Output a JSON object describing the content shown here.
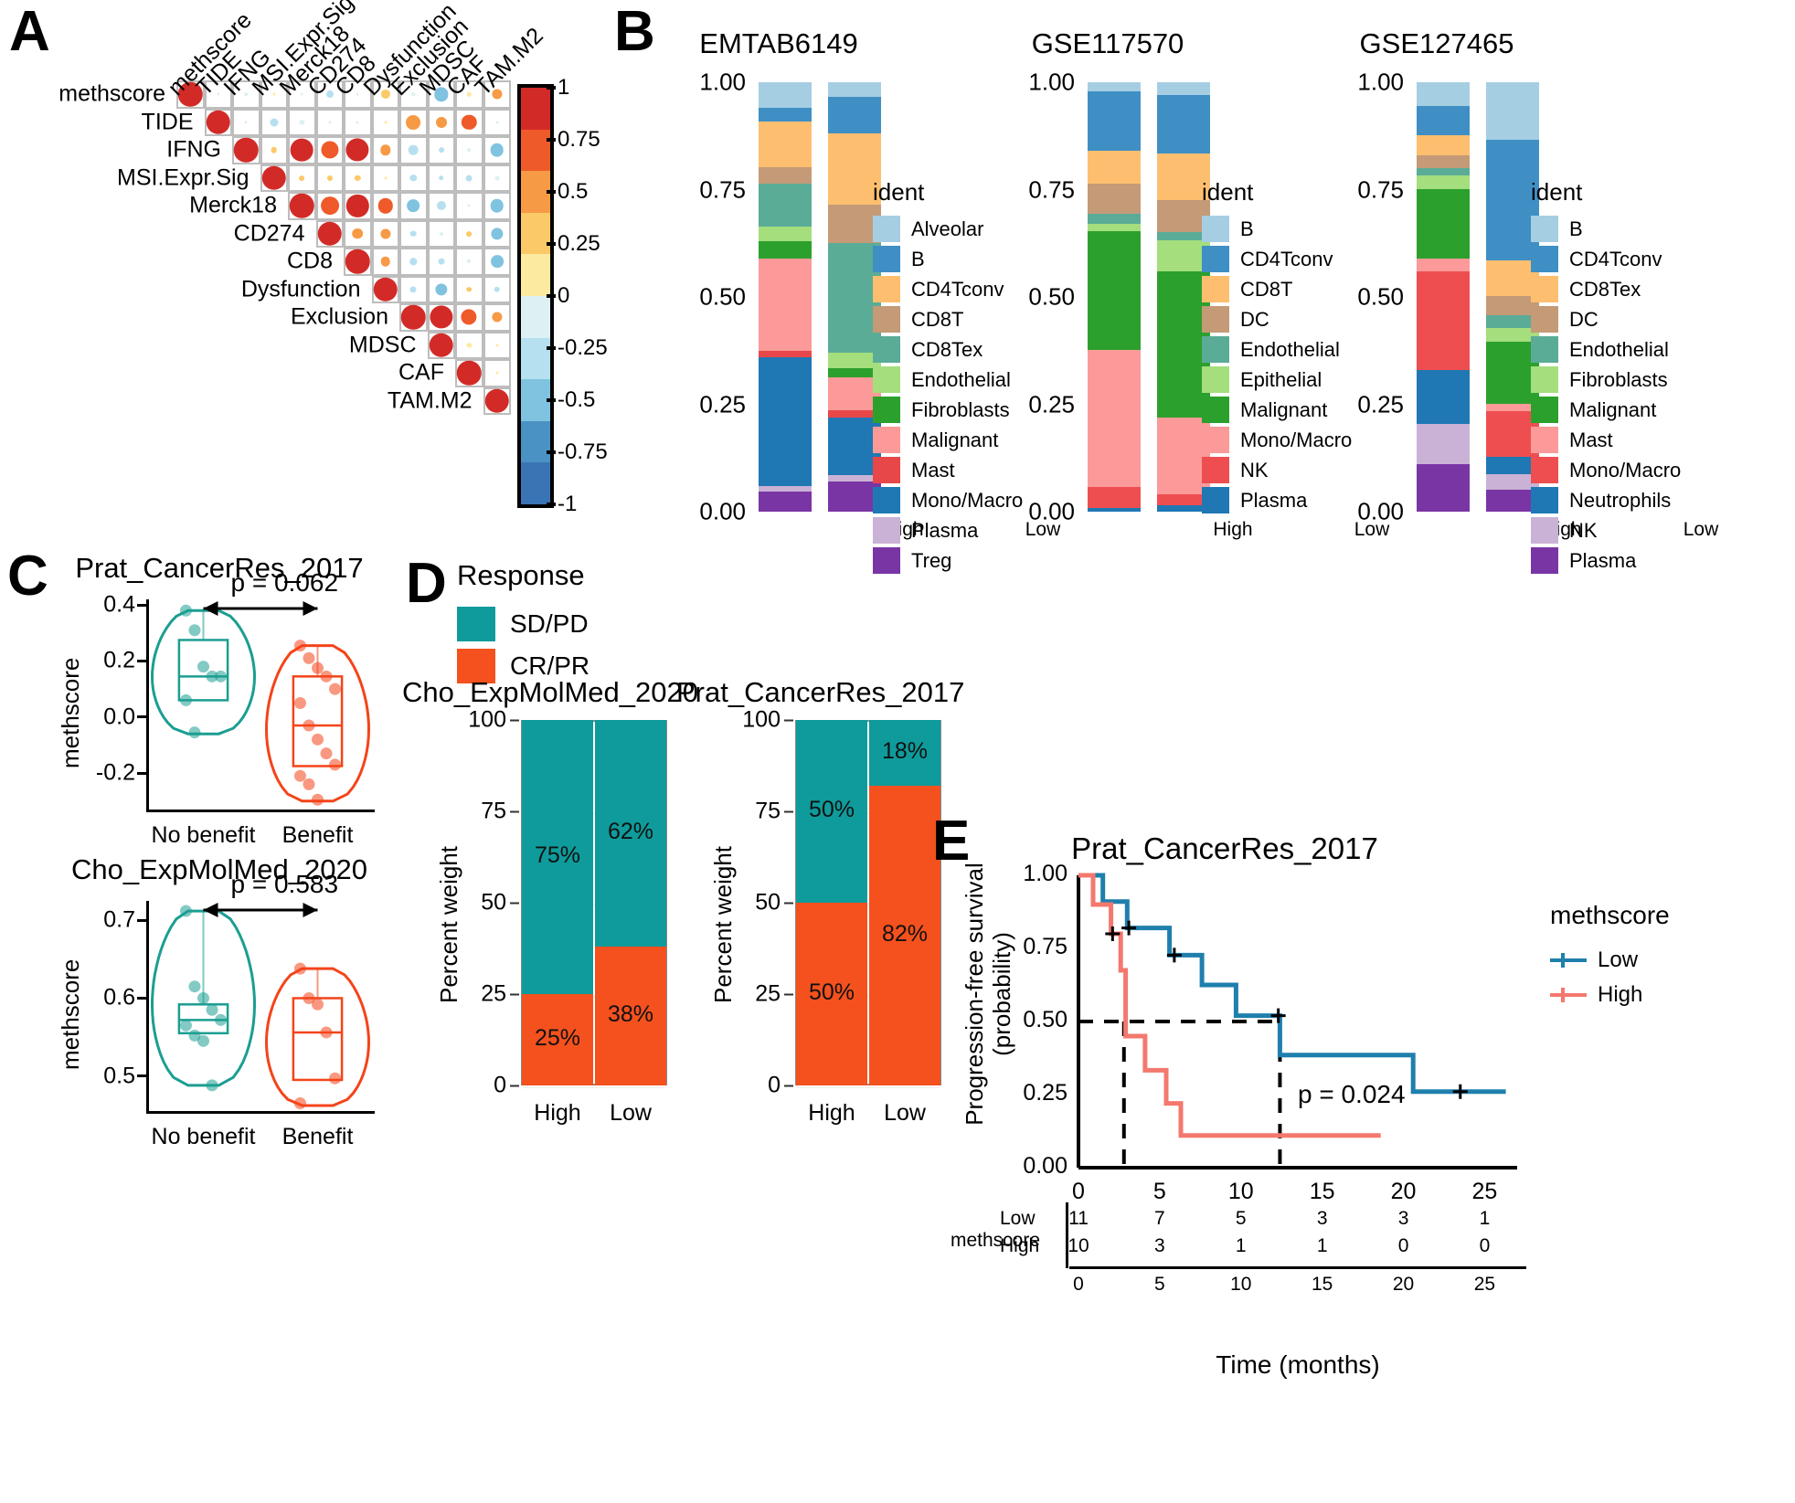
{
  "panels": {
    "A": {
      "letter": "A"
    },
    "B": {
      "letter": "B"
    },
    "C": {
      "letter": "C"
    },
    "D": {
      "letter": "D"
    },
    "E": {
      "letter": "E"
    }
  },
  "chart_data": [
    {
      "panel": "A",
      "type": "heatmap",
      "title": "",
      "subtype": "correlogram-upper-triangle",
      "labels": [
        "methscore",
        "TIDE",
        "IFNG",
        "MSI.Expr.Sig",
        "Merck18",
        "CD274",
        "CD8",
        "Dysfunction",
        "Exclusion",
        "MDSC",
        "CAF",
        "TAM.M2"
      ],
      "colorbar": {
        "ticks": [
          "1",
          "0.75",
          "0.5",
          "0.25",
          "0",
          "-0.25",
          "-0.5",
          "-0.75",
          "-1"
        ],
        "values": [
          1,
          0.75,
          0.5,
          0.25,
          0,
          -0.25,
          -0.5,
          -0.75,
          -1
        ],
        "colors": [
          "#d22b27",
          "#ef5a2a",
          "#f79a45",
          "#fbc968",
          "#fdeaa1",
          "#ddf0f3",
          "#b6e0ef",
          "#80c3e0",
          "#4b92c4",
          "#3a74b5"
        ]
      },
      "matrix": [
        [
          1.0,
          -0.12,
          -0.14,
          0.06,
          -0.11,
          -0.3,
          -0.08,
          0.38,
          -0.13,
          -0.58,
          0.17,
          0.42
        ],
        [
          null,
          1.0,
          -0.12,
          -0.34,
          -0.2,
          -0.05,
          -0.11,
          0.05,
          0.6,
          0.45,
          0.62,
          -0.1
        ],
        [
          null,
          null,
          1.0,
          0.25,
          0.93,
          0.72,
          0.95,
          0.43,
          -0.4,
          -0.22,
          -0.14,
          -0.55
        ],
        [
          null,
          null,
          null,
          1.0,
          0.22,
          0.23,
          0.24,
          0.07,
          -0.28,
          -0.21,
          -0.26,
          -0.18
        ],
        [
          null,
          null,
          null,
          null,
          1.0,
          0.75,
          0.92,
          0.62,
          -0.52,
          -0.38,
          -0.05,
          -0.55
        ],
        [
          null,
          null,
          null,
          null,
          null,
          1.0,
          0.44,
          0.42,
          -0.25,
          -0.15,
          0.22,
          -0.5
        ],
        [
          null,
          null,
          null,
          null,
          null,
          null,
          1.0,
          0.4,
          -0.28,
          -0.26,
          -0.16,
          -0.52
        ],
        [
          null,
          null,
          null,
          null,
          null,
          null,
          null,
          1.0,
          -0.27,
          -0.5,
          0.21,
          -0.25
        ],
        [
          null,
          null,
          null,
          null,
          null,
          null,
          null,
          null,
          1.0,
          0.95,
          0.65,
          0.42
        ],
        [
          null,
          null,
          null,
          null,
          null,
          null,
          null,
          null,
          null,
          1.0,
          0.2,
          0.12
        ],
        [
          null,
          null,
          null,
          null,
          null,
          null,
          null,
          null,
          null,
          null,
          1.0,
          0.08
        ],
        [
          null,
          null,
          null,
          null,
          null,
          null,
          null,
          null,
          null,
          null,
          null,
          1.0
        ]
      ]
    },
    {
      "panel": "B",
      "index": 0,
      "type": "bar",
      "stacked": true,
      "title": "EMTAB6149",
      "xlabel": "",
      "ylabel": "",
      "legend_title": "ident",
      "categories": [
        "High",
        "Low"
      ],
      "yticks": [
        "0.00",
        "0.25",
        "0.50",
        "0.75",
        "1.00"
      ],
      "ylim": [
        0,
        1
      ],
      "series": [
        {
          "name": "Alveolar",
          "color": "#a6cee3",
          "values": [
            0.06,
            0.035
          ]
        },
        {
          "name": "B",
          "color": "#3f8fc5",
          "values": [
            0.032,
            0.085
          ]
        },
        {
          "name": "CD4Tconv",
          "color": "#fdbf6f",
          "values": [
            0.105,
            0.165
          ]
        },
        {
          "name": "CD8T",
          "color": "#c49a77",
          "values": [
            0.04,
            0.09
          ]
        },
        {
          "name": "CD8Tex",
          "color": "#5aac97",
          "values": [
            0.1,
            0.255
          ]
        },
        {
          "name": "Endothelial",
          "color": "#a4de7d",
          "values": [
            0.033,
            0.035
          ]
        },
        {
          "name": "Fibroblasts",
          "color": "#2ca02c",
          "values": [
            0.04,
            0.022
          ]
        },
        {
          "name": "Malignant",
          "color": "#fb9a99",
          "values": [
            0.215,
            0.077
          ]
        },
        {
          "name": "Mast",
          "color": "#e8474a",
          "values": [
            0.015,
            0.016
          ]
        },
        {
          "name": "Mono/Macro",
          "color": "#1f78b4",
          "values": [
            0.3,
            0.135
          ]
        },
        {
          "name": "Plasma",
          "color": "#cab2d6",
          "values": [
            0.013,
            0.016
          ]
        },
        {
          "name": "Treg",
          "color": "#7a35a5",
          "values": [
            0.047,
            0.069
          ]
        }
      ]
    },
    {
      "panel": "B",
      "index": 1,
      "type": "bar",
      "stacked": true,
      "title": "GSE117570",
      "xlabel": "",
      "ylabel": "",
      "legend_title": "ident",
      "categories": [
        "High",
        "Low"
      ],
      "yticks": [
        "0.00",
        "0.25",
        "0.50",
        "0.75",
        "1.00"
      ],
      "ylim": [
        0,
        1
      ],
      "series": [
        {
          "name": "B",
          "color": "#a6cee3",
          "values": [
            0.022,
            0.03
          ]
        },
        {
          "name": "CD4Tconv",
          "color": "#3f8fc5",
          "values": [
            0.137,
            0.135
          ]
        },
        {
          "name": "CD8T",
          "color": "#fdbf6f",
          "values": [
            0.078,
            0.11
          ]
        },
        {
          "name": "DC",
          "color": "#c49a77",
          "values": [
            0.07,
            0.075
          ]
        },
        {
          "name": "Endothelial",
          "color": "#5aac97",
          "values": [
            0.023,
            0.018
          ]
        },
        {
          "name": "Epithelial",
          "color": "#a4de7d",
          "values": [
            0.016,
            0.072
          ]
        },
        {
          "name": "Malignant",
          "color": "#2ca02c",
          "values": [
            0.277,
            0.34
          ]
        },
        {
          "name": "Mono/Macro",
          "color": "#fb9a99",
          "values": [
            0.32,
            0.18
          ]
        },
        {
          "name": "NK",
          "color": "#ef4e50",
          "values": [
            0.049,
            0.025
          ]
        },
        {
          "name": "Plasma",
          "color": "#1f78b4",
          "values": [
            0.008,
            0.015
          ]
        }
      ]
    },
    {
      "panel": "B",
      "index": 2,
      "type": "bar",
      "stacked": true,
      "title": "GSE127465",
      "xlabel": "",
      "ylabel": "",
      "legend_title": "ident",
      "categories": [
        "High",
        "Low"
      ],
      "yticks": [
        "0.00",
        "0.25",
        "0.50",
        "0.75",
        "1.00"
      ],
      "ylim": [
        0,
        1
      ],
      "series": [
        {
          "name": "B",
          "color": "#a6cee3",
          "values": [
            0.055,
            0.135
          ]
        },
        {
          "name": "CD4Tconv",
          "color": "#3f8fc5",
          "values": [
            0.068,
            0.28
          ]
        },
        {
          "name": "CD8Tex",
          "color": "#fdbf6f",
          "values": [
            0.048,
            0.082
          ]
        },
        {
          "name": "DC",
          "color": "#c49a77",
          "values": [
            0.03,
            0.045
          ]
        },
        {
          "name": "Endothelial",
          "color": "#5aac97",
          "values": [
            0.017,
            0.03
          ]
        },
        {
          "name": "Fibroblasts",
          "color": "#a4de7d",
          "values": [
            0.03,
            0.032
          ]
        },
        {
          "name": "Malignant",
          "color": "#2ca02c",
          "values": [
            0.162,
            0.145
          ]
        },
        {
          "name": "Mast",
          "color": "#fb9a99",
          "values": [
            0.03,
            0.018
          ]
        },
        {
          "name": "Mono/Macro",
          "color": "#ef4e50",
          "values": [
            0.23,
            0.105
          ]
        },
        {
          "name": "Neutrophils",
          "color": "#1f78b4",
          "values": [
            0.125,
            0.04
          ]
        },
        {
          "name": "NK",
          "color": "#cab2d6",
          "values": [
            0.095,
            0.038
          ]
        },
        {
          "name": "Plasma",
          "color": "#7a35a5",
          "values": [
            0.11,
            0.05
          ]
        }
      ]
    },
    {
      "panel": "C",
      "index": 0,
      "type": "scatter",
      "subtype": "violin-box",
      "title": "Prat_CancerRes_2017",
      "xlabel": "",
      "ylabel": "methscore",
      "categories": [
        "No benefit",
        "Benefit"
      ],
      "yticks": [
        "0.4",
        "0.2",
        "0.0",
        "-0.2"
      ],
      "ylim": [
        -0.33,
        0.42
      ],
      "annotation": "p =  0.062",
      "groups": [
        {
          "name": "No benefit",
          "color": "#1b9e91",
          "q1": 0.06,
          "median": 0.145,
          "q3": 0.275,
          "min": -0.06,
          "max": 0.38,
          "points": [
            0.38,
            0.31,
            0.18,
            0.145,
            0.145,
            0.06,
            -0.055
          ]
        },
        {
          "name": "Benefit",
          "color": "#f4441a",
          "q1": -0.175,
          "median": -0.03,
          "q3": 0.145,
          "min": -0.3,
          "max": 0.255,
          "points": [
            0.255,
            0.21,
            0.175,
            0.145,
            0.1,
            0.05,
            -0.03,
            -0.08,
            -0.13,
            -0.17,
            -0.21,
            -0.24,
            -0.295
          ]
        }
      ]
    },
    {
      "panel": "C",
      "index": 1,
      "type": "scatter",
      "subtype": "violin-box",
      "title": "Cho_ExpMolMed_2020",
      "xlabel": "",
      "ylabel": "methscore",
      "categories": [
        "No benefit",
        "Benefit"
      ],
      "yticks": [
        "0.7",
        "0.6",
        "0.5"
      ],
      "ylim": [
        0.455,
        0.725
      ],
      "annotation": "p =  0.583",
      "groups": [
        {
          "name": "No benefit",
          "color": "#1b9e91",
          "q1": 0.555,
          "median": 0.572,
          "q3": 0.592,
          "min": 0.488,
          "max": 0.712,
          "points": [
            0.712,
            0.615,
            0.6,
            0.585,
            0.572,
            0.565,
            0.552,
            0.545,
            0.488
          ]
        },
        {
          "name": "Benefit",
          "color": "#f4441a",
          "q1": 0.495,
          "median": 0.556,
          "q3": 0.6,
          "min": 0.462,
          "max": 0.638,
          "points": [
            0.638,
            0.6,
            0.592,
            0.556,
            0.497,
            0.465
          ]
        }
      ]
    },
    {
      "panel": "D",
      "index": 0,
      "type": "bar",
      "stacked": true,
      "title": "Cho_ExpMolMed_2020",
      "xlabel": "",
      "ylabel": "Percent weight",
      "legend_title": "Response",
      "categories": [
        "High",
        "Low"
      ],
      "yticks": [
        "0",
        "25",
        "50",
        "75",
        "100"
      ],
      "ylim": [
        0,
        100
      ],
      "series": [
        {
          "name": "CR/PR",
          "color": "#f4511e",
          "values": [
            25,
            38
          ],
          "labels": [
            "25%",
            "38%"
          ]
        },
        {
          "name": "SD/PD",
          "color": "#0f9b9b",
          "values": [
            75,
            62
          ],
          "labels": [
            "75%",
            "62%"
          ]
        }
      ]
    },
    {
      "panel": "D",
      "index": 1,
      "type": "bar",
      "stacked": true,
      "title": "Prat_CancerRes_2017",
      "xlabel": "",
      "ylabel": "Percent weight",
      "legend_title": "Response",
      "categories": [
        "High",
        "Low"
      ],
      "yticks": [
        "0",
        "25",
        "50",
        "75",
        "100"
      ],
      "ylim": [
        0,
        100
      ],
      "series": [
        {
          "name": "CR/PR",
          "color": "#f4511e",
          "values": [
            50,
            82
          ],
          "labels": [
            "50%",
            "82%"
          ]
        },
        {
          "name": "SD/PD",
          "color": "#0f9b9b",
          "values": [
            50,
            18
          ],
          "labels": [
            "50%",
            "18%"
          ]
        }
      ]
    },
    {
      "panel": "E",
      "type": "line",
      "subtype": "kaplan-meier",
      "title": "Prat_CancerRes_2017",
      "xlabel": "Time (months)",
      "ylabel": "Progression-free survival\n(probability)",
      "legend_title": "methscore",
      "xticks": [
        "0",
        "5",
        "10",
        "15",
        "20",
        "25"
      ],
      "yticks": [
        "0.00",
        "0.25",
        "0.50",
        "0.75",
        "1.00"
      ],
      "xlim": [
        0,
        27
      ],
      "ylim": [
        0,
        1
      ],
      "annotation": "p = 0.024",
      "median_lines": {
        "low": 12.4,
        "high": 2.8,
        "level": 0.5
      },
      "series": [
        {
          "name": "Low",
          "color": "#1f7fad",
          "steps": [
            [
              0,
              1.0
            ],
            [
              1.5,
              1.0
            ],
            [
              1.5,
              0.91
            ],
            [
              3.0,
              0.91
            ],
            [
              3.0,
              0.82
            ],
            [
              5.6,
              0.82
            ],
            [
              5.6,
              0.727
            ],
            [
              7.6,
              0.727
            ],
            [
              7.6,
              0.625
            ],
            [
              9.7,
              0.625
            ],
            [
              9.7,
              0.52
            ],
            [
              12.4,
              0.52
            ],
            [
              12.4,
              0.385
            ],
            [
              20.6,
              0.385
            ],
            [
              20.6,
              0.26
            ],
            [
              26.3,
              0.26
            ]
          ],
          "censors": [
            [
              3.1,
              0.82
            ],
            [
              5.9,
              0.727
            ],
            [
              12.3,
              0.52
            ],
            [
              23.5,
              0.26
            ]
          ]
        },
        {
          "name": "High",
          "color": "#f4786e",
          "steps": [
            [
              0,
              1.0
            ],
            [
              0.9,
              1.0
            ],
            [
              0.9,
              0.9
            ],
            [
              2.0,
              0.9
            ],
            [
              2.0,
              0.8
            ],
            [
              2.6,
              0.8
            ],
            [
              2.6,
              0.675
            ],
            [
              2.9,
              0.675
            ],
            [
              2.9,
              0.45
            ],
            [
              4.1,
              0.45
            ],
            [
              4.1,
              0.333
            ],
            [
              5.4,
              0.333
            ],
            [
              5.4,
              0.22
            ],
            [
              6.3,
              0.22
            ],
            [
              6.3,
              0.11
            ],
            [
              18.6,
              0.11
            ]
          ],
          "censors": [
            [
              2.1,
              0.8
            ]
          ]
        }
      ],
      "risk_table": {
        "row_label": "methscore",
        "times": [
          "0",
          "5",
          "10",
          "15",
          "20",
          "25"
        ],
        "rows": [
          {
            "label": "Low",
            "color": "#1f7fad",
            "counts": [
              "11",
              "7",
              "5",
              "3",
              "3",
              "1"
            ]
          },
          {
            "label": "High",
            "color": "#f4786e",
            "counts": [
              "10",
              "3",
              "1",
              "1",
              "0",
              "0"
            ]
          }
        ]
      }
    }
  ]
}
